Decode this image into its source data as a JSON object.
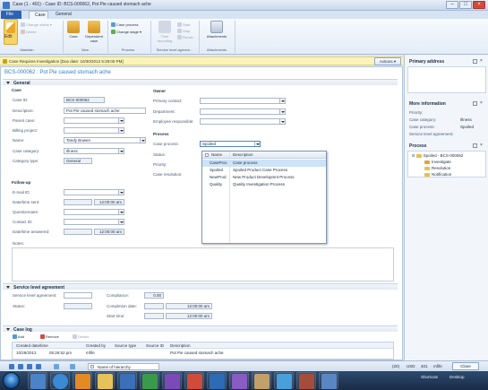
{
  "window": {
    "title": "Case (1 - 401) - Case ID: BCS-000062, Pot Pie caused stomach ache"
  },
  "ribbon": {
    "tabs": [
      "File",
      "Case",
      "General"
    ],
    "maintain": {
      "label": "Maintain",
      "edit": "Edit",
      "change_status": "Change status",
      "delete": "Delete"
    },
    "new": {
      "label": "New",
      "case": "Case",
      "dependent_case": "Dependent case"
    },
    "process": {
      "label": "Process",
      "case_process": "Case process",
      "change_stage": "Change stage"
    },
    "sla": {
      "label": "Service level agreem...",
      "time_recording": "Time recording",
      "start": "Start",
      "stop": "Stop",
      "recalc": "Recalc"
    },
    "attachments": {
      "label": "Attachments",
      "button": "Attachments"
    }
  },
  "notification": {
    "text": "Case Requires Investigation  [Due date: 10/30/2012 5:28:00 PM]",
    "actions": "Actions"
  },
  "form": {
    "heading": "BCS-000062 : Pot Pie caused stomach ache",
    "general_label": "General",
    "case": {
      "header": "Case",
      "case_id_label": "Case ID:",
      "case_id": "BCS-000062",
      "description_label": "Description:",
      "description": "Pot Pie caused stomach ache",
      "parent_case_label": "Parent case:",
      "parent_case": "",
      "billing_project_label": "Billing project:",
      "billing_project": "",
      "name_label": "Name:",
      "name": "Tandy Bowen",
      "case_category_label": "Case category:",
      "case_category": "Illness",
      "category_type_label": "Category type:",
      "category_type": "General"
    },
    "owner": {
      "header": "Owner",
      "primary_contact_label": "Primary contact:",
      "department_label": "Department:",
      "employee_responsible_label": "Employee responsible:"
    },
    "process": {
      "header": "Process",
      "case_process_label": "Case process:",
      "case_process": "Spoiled",
      "status_label": "Status:",
      "priority_label": "Priority:",
      "case_resolution_label": "Case resolution:"
    },
    "followup": {
      "header": "Follow-up",
      "email_id_label": "E-mail ID:",
      "datetime_sent_label": "Date/time sent:",
      "datetime_sent": "12:00:00 am",
      "questionnaire_label": "Questionnaire:",
      "contact_id_label": "Contact ID:",
      "datetime_answered_label": "Date/time answered:",
      "datetime_answered": "12:00:00 am"
    },
    "notes_label": "Notes:",
    "sla": {
      "header": "Service level agreement",
      "sla_label": "Service level agreement:",
      "status_label": "Status:",
      "compliance_label": "Compliance:",
      "compliance": "0.00",
      "completion_label": "Completion date:",
      "completion": "12:00:00 am",
      "start_label": "Start time:",
      "start": "12:00:00 am"
    },
    "case_log": {
      "header": "Case log",
      "add": "Add",
      "remove": "Remove",
      "details": "Details",
      "columns": [
        "Created date/time",
        "Created by",
        "Source type",
        "Source ID",
        "Description"
      ],
      "rows": [
        [
          "10/29/2012",
          "05:26:52 pm",
          "mfife",
          "",
          "",
          "Pot Pie caused stomach ache"
        ]
      ]
    }
  },
  "process_popup": {
    "columns": [
      "Name",
      "Description"
    ],
    "rows": [
      [
        "CaseProc",
        "Case process"
      ],
      [
        "Spoiled",
        "Spoiled Product Case Process"
      ],
      [
        "NewProd",
        "New Product Developmnt Process"
      ],
      [
        "Quality",
        "Quality Investigation Process"
      ]
    ]
  },
  "right_pane": {
    "primary_address": "Primary address",
    "more_info": "More information",
    "priority_label": "Priority:",
    "case_category_label": "Case category:",
    "case_category": "Illness",
    "case_process_label": "Case process:",
    "case_process": "Spoiled",
    "sla_label": "Service level agreement:",
    "process_header": "Process",
    "tree": [
      "Spoiled - BCS-000062",
      "Investigate",
      "Resolution",
      "Notification"
    ]
  },
  "status_bar": {
    "name_of_hierarchy": "Name of hierarchy",
    "count": "(20)",
    "currency": "USD",
    "company": "401",
    "user": "mfife",
    "close": "Close"
  },
  "taskbar": {
    "shortcuts": "Shortcuts",
    "desktop": "Desktop"
  }
}
